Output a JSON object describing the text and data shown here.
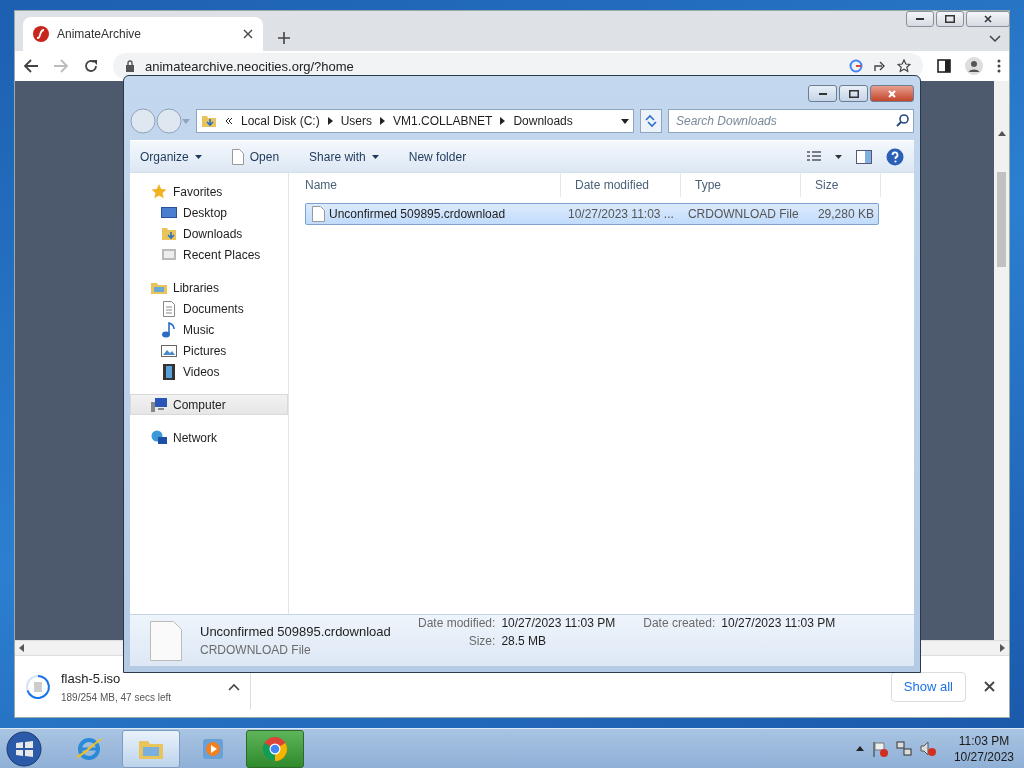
{
  "browser": {
    "tabs": [
      {
        "title": "AnimateArchive",
        "selected": true
      }
    ],
    "address": "animatearchive.neocities.org/?home",
    "downloads": [
      {
        "filename": "flash-5.iso",
        "status": "189/254 MB, 47 secs left"
      }
    ],
    "show_all": "Show all"
  },
  "explorer": {
    "breadcrumb": [
      "Local Disk (C:)",
      "Users",
      "VM1.COLLABNET",
      "Downloads"
    ],
    "search_placeholder": "Search Downloads",
    "toolbar": [
      {
        "label": "Organize",
        "kind": "menu"
      },
      {
        "label": "Open",
        "kind": "file"
      },
      {
        "label": "Share with",
        "kind": "menu"
      },
      {
        "label": "New folder",
        "kind": "plain"
      }
    ],
    "nav": [
      {
        "label": "Favorites",
        "kind": "star",
        "selected": false,
        "children": [
          {
            "label": "Desktop",
            "kind": "desktop",
            "selected": false
          },
          {
            "label": "Downloads",
            "kind": "downloads",
            "selected": false
          },
          {
            "label": "Recent Places",
            "kind": "recent",
            "selected": false
          }
        ]
      },
      {
        "label": "Libraries",
        "kind": "libraries",
        "selected": false,
        "children": [
          {
            "label": "Documents",
            "kind": "document",
            "selected": false
          },
          {
            "label": "Music",
            "kind": "music",
            "selected": false
          },
          {
            "label": "Pictures",
            "kind": "pictures",
            "selected": false
          },
          {
            "label": "Videos",
            "kind": "videos",
            "selected": false
          }
        ]
      },
      {
        "label": "Computer",
        "kind": "computer",
        "selected": true
      },
      {
        "label": "Network",
        "kind": "network",
        "selected": false
      }
    ],
    "columns": [
      "Name",
      "Date modified",
      "Type",
      "Size"
    ],
    "files": [
      {
        "name": "Unconfirmed 509895.crdownload",
        "date": "10/27/2023 11:03 ...",
        "type": "CRDOWNLOAD File",
        "size": "29,280 KB",
        "selected": true
      }
    ],
    "details": {
      "name": "Unconfirmed 509895.crdownload",
      "type": "CRDOWNLOAD File",
      "fields": [
        {
          "label": "Date modified:",
          "value": "10/27/2023 11:03 PM"
        },
        {
          "label": "Size:",
          "value": "28.5 MB"
        },
        {
          "label": "Date created:",
          "value": "10/27/2023 11:03 PM"
        }
      ]
    }
  },
  "taskbar": {
    "buttons": [
      {
        "kind": "ie",
        "selected": false,
        "attention": false
      },
      {
        "kind": "folder",
        "selected": true,
        "attention": false
      },
      {
        "kind": "media",
        "selected": false,
        "attention": false
      },
      {
        "kind": "chrome",
        "selected": false,
        "attention": true
      }
    ],
    "time": "11:03 PM",
    "date": "10/27/2023"
  }
}
